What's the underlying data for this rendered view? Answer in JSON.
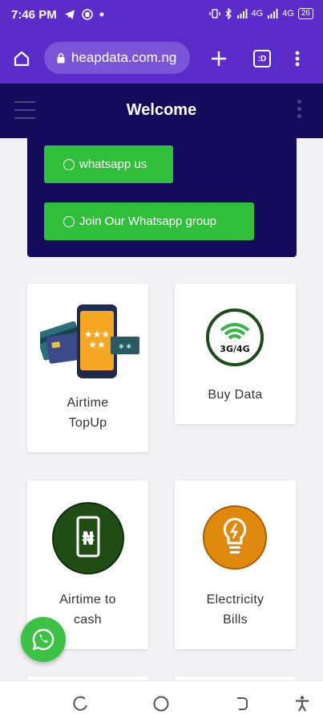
{
  "status_bar": {
    "time": "7:46 PM",
    "indicators": [
      "telegram-icon",
      "notification-icon",
      "dot"
    ],
    "right_icons": [
      "vibrate-icon",
      "bluetooth-icon",
      "signal-icon",
      "signal-icon"
    ],
    "network_label_1": "4G",
    "network_label_2": "4G",
    "battery": "26"
  },
  "browser": {
    "url": "heapdata.com.ng",
    "tab_count": ":D"
  },
  "header": {
    "title": "Welcome"
  },
  "whatsapp_panel": {
    "whatsapp_us_label": "whatsapp us",
    "join_group_label": "Join Our Whatsapp group"
  },
  "services": [
    {
      "label_line1": "Airtime",
      "label_line2": "TopUp",
      "icon": "airtime-topup-icon"
    },
    {
      "label_line1": "Buy Data",
      "label_line2": "",
      "icon": "buy-data-icon"
    },
    {
      "label_line1": "Airtime to",
      "label_line2": "cash",
      "icon": "airtime-to-cash-icon"
    },
    {
      "label_line1": "Electricity",
      "label_line2": "Bills",
      "icon": "electricity-bills-icon"
    }
  ],
  "data_badge": "3G/4G",
  "currency_symbol": "₦",
  "colors": {
    "browser_purple": "#5b2cc9",
    "header_navy": "#140b5c",
    "whatsapp_green": "#2fbf3b",
    "dark_green": "#1f4d14",
    "electric_orange": "#e08a0d"
  }
}
